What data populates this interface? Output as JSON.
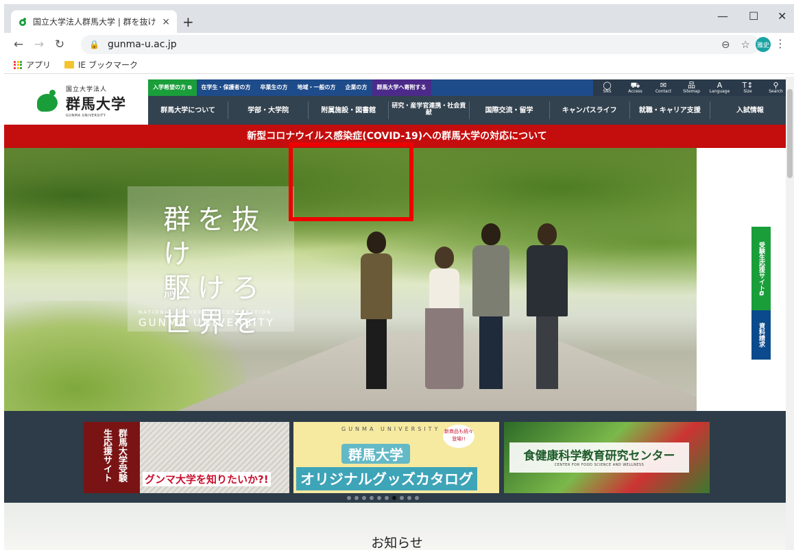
{
  "browser": {
    "tab_title": "国立大学法人群馬大学 | 群を抜け",
    "tab_close": "×",
    "new_tab": "+",
    "window_minimize": "—",
    "window_maximize": "☐",
    "window_close": "✕",
    "url": "gunma-u.ac.jp",
    "profile_initials": "雅史",
    "bookmarks": [
      {
        "label": "アプリ",
        "icon": "apps-grid-icon"
      },
      {
        "label": "IE ブックマーク",
        "icon": "folder-icon"
      }
    ]
  },
  "site": {
    "logo": {
      "small": "国立大学法人",
      "name": "群馬大学",
      "en": "GUNMA UNIVERSITY"
    },
    "audience_links": [
      {
        "label": "入学希望の方 ⧉",
        "style": "green"
      },
      {
        "label": "在学生・保護者の方",
        "style": "plain"
      },
      {
        "label": "卒業生の方",
        "style": "plain"
      },
      {
        "label": "地域・一般の方",
        "style": "plain"
      },
      {
        "label": "企業の方",
        "style": "plain"
      },
      {
        "label": "群馬大学へ寄附する",
        "style": "purple"
      }
    ],
    "utility_icons": [
      {
        "glyph": "◯",
        "label": "SNS"
      },
      {
        "glyph": "⛟",
        "label": "Access"
      },
      {
        "glyph": "✉",
        "label": "Contact"
      },
      {
        "glyph": "品",
        "label": "Sitemap"
      },
      {
        "glyph": "A",
        "label": "Language"
      },
      {
        "glyph": "T↕",
        "label": "Size"
      },
      {
        "glyph": "⚲",
        "label": "Search"
      }
    ],
    "main_nav": [
      "群馬大学について",
      "学部・大学院",
      "附属施設・図書館",
      "研究・産学官連携・社会貢献",
      "国際交流・留学",
      "キャンパスライフ",
      "就職・キャリア支援",
      "入試情報"
    ],
    "covid_banner": "新型コロナウイルス感染症(COVID-19)への群馬大学の対応について",
    "hero": {
      "catch_lines": [
        "群を抜け",
        "駆けろ",
        "世界を"
      ],
      "catch_sub": "NATIONAL UNIVERSITY CORPORATION",
      "catch_uni": "GUNMA UNIVERSITY"
    },
    "side_buttons": {
      "applicant": "受験生応援サイト⧉",
      "materials": "資料請求"
    },
    "banners": [
      {
        "side": "群馬大学受験生応援サイト",
        "caption": "グンマ大学を知りたいか?!"
      },
      {
        "ring": "GUNMA UNIVERSITY",
        "title": "群馬大学",
        "subtitle": "オリジナルグッズカタログ",
        "stamp": "新商品も続々登場!!"
      },
      {
        "title": "食健康科学教育研究センター",
        "en": "CENTER FOR FOOD SCIENCE AND WELLNESS"
      }
    ],
    "carousel_dot_count": 10,
    "carousel_active_index": 6,
    "news_heading": "お知らせ"
  },
  "colors": {
    "covid_red": "#c40d0d",
    "nav_dark": "#33424f",
    "topbar_blue": "#1e4b8a",
    "brand_green": "#1a9e3a",
    "highlight_red": "#ee0000"
  }
}
